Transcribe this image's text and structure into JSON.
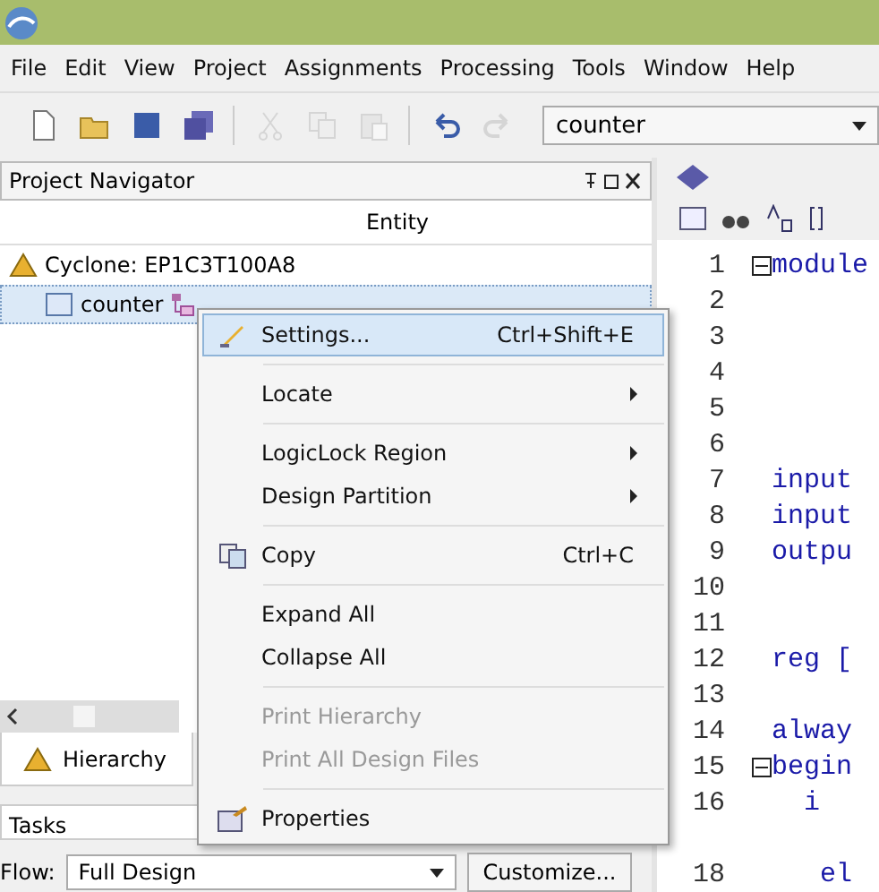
{
  "menu_bar": [
    "File",
    "Edit",
    "View",
    "Project",
    "Assignments",
    "Processing",
    "Tools",
    "Window",
    "Help"
  ],
  "toolbar": {
    "buttons": [
      {
        "kind": "new",
        "disabled": false
      },
      {
        "kind": "open",
        "disabled": false
      },
      {
        "kind": "save",
        "disabled": false
      },
      {
        "kind": "save-all",
        "disabled": false
      },
      {
        "kind": "cut",
        "disabled": true
      },
      {
        "kind": "copy",
        "disabled": true
      },
      {
        "kind": "paste",
        "disabled": true
      },
      {
        "kind": "undo",
        "disabled": false
      },
      {
        "kind": "redo",
        "disabled": true
      }
    ],
    "project_select": "counter"
  },
  "project_navigator": {
    "title": "Project Navigator",
    "column": "Entity",
    "tree": [
      {
        "label": "Cyclone: EP1C3T100A8",
        "selected": false,
        "children": [
          {
            "label": "counter",
            "selected": true
          }
        ]
      }
    ],
    "tab": "Hierarchy"
  },
  "tasks": {
    "title": "Tasks",
    "flow_label": "Flow:",
    "flow_value": "Full Design",
    "customize": "Customize..."
  },
  "context_menu": [
    {
      "kind": "item",
      "label": "Settings...",
      "shortcut": "Ctrl+Shift+E",
      "submenu": false,
      "disabled": false,
      "selected": true
    },
    {
      "kind": "separator"
    },
    {
      "kind": "item",
      "label": "Locate",
      "submenu": true,
      "disabled": false,
      "selected": false
    },
    {
      "kind": "separator"
    },
    {
      "kind": "item",
      "label": "LogicLock Region",
      "submenu": true,
      "disabled": false,
      "selected": false
    },
    {
      "kind": "item",
      "label": "Design Partition",
      "submenu": true,
      "disabled": false,
      "selected": false
    },
    {
      "kind": "separator"
    },
    {
      "kind": "item",
      "label": "Copy",
      "shortcut": "Ctrl+C",
      "submenu": false,
      "disabled": false,
      "selected": false
    },
    {
      "kind": "separator"
    },
    {
      "kind": "item",
      "label": "Expand All",
      "submenu": false,
      "disabled": false,
      "selected": false
    },
    {
      "kind": "item",
      "label": "Collapse All",
      "submenu": false,
      "disabled": false,
      "selected": false
    },
    {
      "kind": "separator"
    },
    {
      "kind": "item",
      "label": "Print Hierarchy",
      "submenu": false,
      "disabled": true,
      "selected": false
    },
    {
      "kind": "item",
      "label": "Print All Design Files",
      "submenu": false,
      "disabled": true,
      "selected": false
    },
    {
      "kind": "separator"
    },
    {
      "kind": "item",
      "label": "Properties",
      "submenu": false,
      "disabled": false,
      "selected": false
    }
  ],
  "editor": {
    "lines": [
      {
        "number": "1",
        "text": "module",
        "fold": true
      },
      {
        "number": "2",
        "fold": false
      },
      {
        "number": "3",
        "fold": false
      },
      {
        "number": "4",
        "fold": false
      },
      {
        "number": "5",
        "fold": false
      },
      {
        "number": "6",
        "fold": false
      },
      {
        "number": "7",
        "text": "input",
        "fold": false
      },
      {
        "number": "8",
        "text": "input",
        "fold": false
      },
      {
        "number": "9",
        "text": "outpu",
        "fold": false
      },
      {
        "number": "10",
        "fold": false
      },
      {
        "number": "11",
        "fold": false
      },
      {
        "number": "12",
        "text": "reg [",
        "fold": false
      },
      {
        "number": "13",
        "fold": false
      },
      {
        "number": "14",
        "text": "alway",
        "fold": false
      },
      {
        "number": "15",
        "text": "begin",
        "fold": true
      },
      {
        "number": "16",
        "text": "  i",
        "fold": false
      },
      {
        "fold": false
      },
      {
        "number": "18",
        "text": "   el",
        "fold": false
      }
    ]
  }
}
